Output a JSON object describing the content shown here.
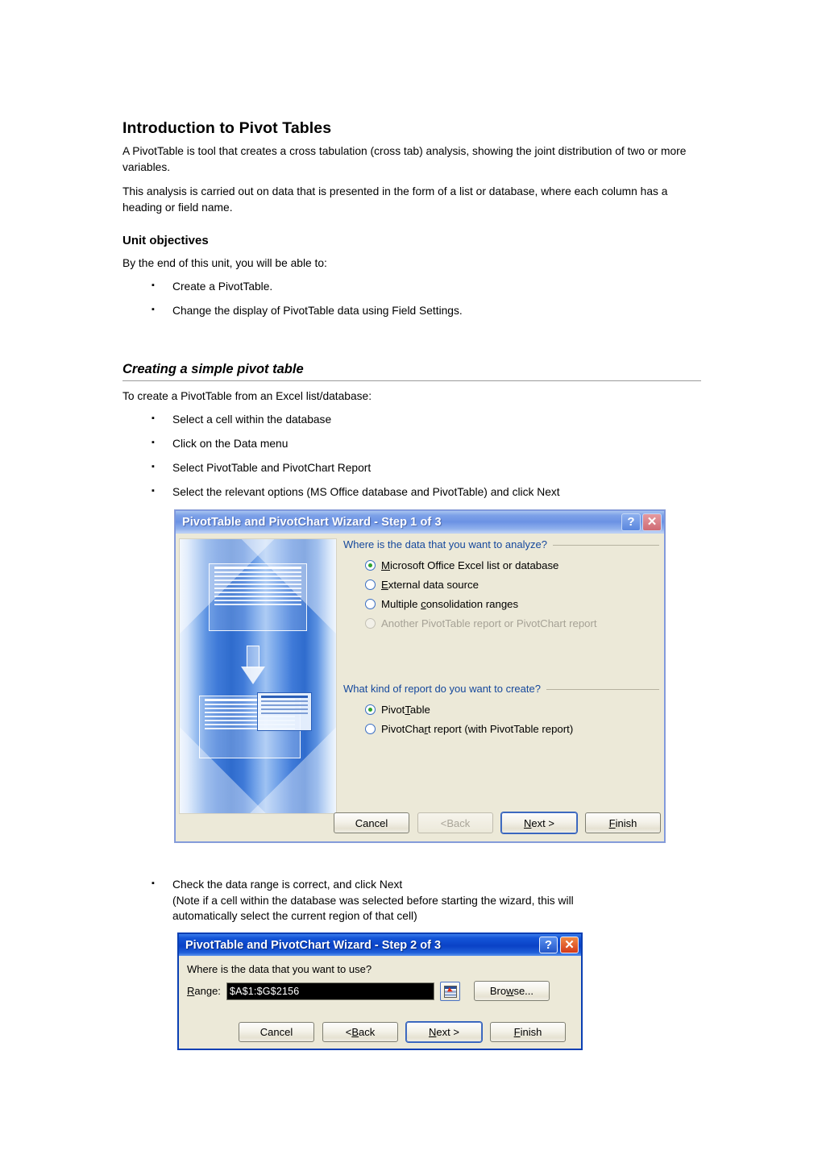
{
  "document": {
    "title": "Introduction to Pivot Tables",
    "intro_paragraph_1": "A PivotTable is tool that creates a cross tabulation (cross tab) analysis, showing the joint distribution of two or more variables.",
    "intro_paragraph_2": "This analysis is carried out on data that is presented in the form of a list or database, where each column has a heading or field name.",
    "objectives_heading": "Unit objectives",
    "objectives_lead": "By the end of this unit, you will be able to:",
    "objectives": [
      "Create a PivotTable.",
      "Change the display of PivotTable data using Field Settings."
    ],
    "section_heading": "Creating a simple pivot table",
    "section_lead": "To create a PivotTable from an Excel list/database:",
    "steps": [
      "Select a cell within the database",
      "Click on the Data menu",
      "Select PivotTable and PivotChart Report",
      "Select the relevant options (MS Office database and PivotTable) and click Next"
    ],
    "check_step_line_1": "Check the data range is correct, and click Next",
    "check_step_line_2": "(Note if  a cell within the database was selected before starting the wizard, this will",
    "check_step_line_3": "automatically select the current region of that cell)"
  },
  "dialog_step1": {
    "title": "PivotTable and PivotChart Wizard - Step 1 of 3",
    "help_button": "?",
    "close_button": "✕",
    "group1_legend": "Where is the data that you want to analyze?",
    "group1_options": [
      {
        "label_pre": "",
        "label_acc": "M",
        "label_post": "icrosoft Office Excel list or database",
        "selected": true,
        "disabled": false
      },
      {
        "label_pre": "",
        "label_acc": "E",
        "label_post": "xternal data source",
        "selected": false,
        "disabled": false
      },
      {
        "label_pre": "Multiple ",
        "label_acc": "c",
        "label_post": "onsolidation ranges",
        "selected": false,
        "disabled": false
      },
      {
        "label_pre": "Another PivotTable report or PivotChart report",
        "label_acc": "",
        "label_post": "",
        "selected": false,
        "disabled": true
      }
    ],
    "group2_legend": "What kind of report do you want to create?",
    "group2_options": [
      {
        "label_pre": "Pivot",
        "label_acc": "T",
        "label_post": "able",
        "selected": true,
        "disabled": false
      },
      {
        "label_pre": "PivotCha",
        "label_acc": "r",
        "label_post": "t report (with PivotTable report)",
        "selected": false,
        "disabled": false
      }
    ],
    "buttons": [
      {
        "label_pre": "Cancel",
        "label_acc": "",
        "label_post": "",
        "disabled": false,
        "default": false
      },
      {
        "label_pre": "< ",
        "label_acc": "B",
        "label_post": "ack",
        "disabled": true,
        "default": false
      },
      {
        "label_pre": "",
        "label_acc": "N",
        "label_post": "ext >",
        "disabled": false,
        "default": true
      },
      {
        "label_pre": "",
        "label_acc": "F",
        "label_post": "inish",
        "disabled": false,
        "default": false
      }
    ]
  },
  "dialog_step2": {
    "title": "PivotTable and PivotChart Wizard - Step 2 of 3",
    "help_button": "?",
    "close_button": "✕",
    "prompt": "Where is the data that you want to use?",
    "range_label_pre": "",
    "range_label_acc": "R",
    "range_label_post": "ange:",
    "range_value": "$A$1:$G$2156",
    "browse_pre": "Bro",
    "browse_acc": "w",
    "browse_post": "se...",
    "buttons": [
      {
        "label_pre": "Cancel",
        "label_acc": "",
        "label_post": "",
        "disabled": false,
        "default": false
      },
      {
        "label_pre": "< ",
        "label_acc": "B",
        "label_post": "ack",
        "disabled": false,
        "default": false
      },
      {
        "label_pre": "",
        "label_acc": "N",
        "label_post": "ext >",
        "disabled": false,
        "default": true
      },
      {
        "label_pre": "",
        "label_acc": "F",
        "label_post": "inish",
        "disabled": false,
        "default": false
      }
    ]
  },
  "colors": {
    "dialog_face": "#ECE9D8",
    "legend_text": "#15489C",
    "radio_ring": "#3A6FC4",
    "radio_dot": "#2FA32F",
    "dialog2_border": "#0A3FB3",
    "range_field_bg": "#000000"
  }
}
